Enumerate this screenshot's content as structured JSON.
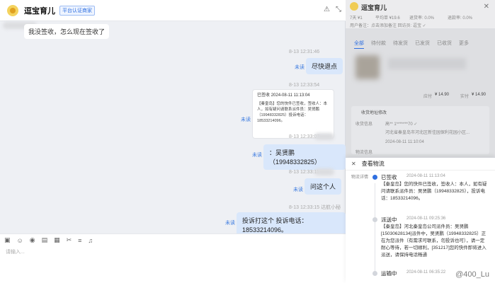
{
  "chat": {
    "shop_name": "逗宝育儿",
    "shop_badge": "平台认证商家",
    "incoming_1": "我没签收，怎么现在签收了",
    "ts_1": "8-13 12:31:46",
    "out_1": "尽快退点",
    "read_1": "未读",
    "ts_2": "8-13 12:33:54",
    "card_title": "已签收",
    "card_time": "2024-08-11 11:13:04",
    "card_body": "【秦皇岛】您的快件已签收，签收人：本人，如有疑问请联系派件员：吴贤鹏（19948332825）投诉电话：18533214096。",
    "read_2": "未读",
    "ts_3": "8-13 12:33:07",
    "out_2": "：吴贤鹏（19948332825）",
    "read_3": "未读",
    "ts_4": "8-13 12:33:11",
    "out_3": "问这个人",
    "read_4": "未读",
    "ts_5": "8-13 12:33:15 达航小秘",
    "out_4": "投诉打这个 投诉电话：18533214096。",
    "read_5": "未读",
    "input_placeholder": "请输入..."
  },
  "panel": {
    "title": "逗宝育儿",
    "stat_a": "7天 ¥1",
    "stat_b": "平均单 ¥19.6",
    "stat_c": "退货率: 0.0%",
    "stat_d": "退款率: 0.0%",
    "stat_e": "用户备注：点击添加备注  回访员: 逗宝 ✓",
    "tabs": [
      "全部",
      "待付款",
      "待发货",
      "已发货",
      "已收货",
      "更多"
    ],
    "price_label_1": "应付",
    "price_value_1": "¥ 14.90",
    "price_label_2": "实付",
    "price_value_2": "¥ 14.90",
    "logi_title": "收货地址修改",
    "logi_receiver": "收货信息",
    "logi_name": "高**  1*******70 ✓",
    "logi_addr": "河北省秦皇岛市河北区新佳园保利花园小区...",
    "logi_time": "2024-08-11 11:10:04",
    "logi_status": "物流信息"
  },
  "popup": {
    "title": "查看物流",
    "side_label": "物流详情",
    "events": [
      {
        "status": "已签收",
        "time": "2024-08-11 11:13:04",
        "detail": "【秦皇岛】您的快件已签收，签收人：本人，如有疑问请联系派件员：吴贤鹏（19948332825），投诉电话：18533214096。",
        "active": true
      },
      {
        "status": "派送中",
        "time": "2024-08-11 09:25:36",
        "detail": "【秦皇岛】河北秦皇岛公司派件员：吴贤鹏[15030628134]派件中，吴贤鹏（19948332825）正在为您派件（有需求可联系，勿投诉也可），请一定耐心等待，若一切顺利，[351217]您的快件即将进入派送，请保持电话畅通",
        "active": false
      },
      {
        "status": "运输中",
        "time": "2024-08-11 06:35:22",
        "detail": "",
        "active": false
      }
    ],
    "watermark": "@400_Lu"
  }
}
